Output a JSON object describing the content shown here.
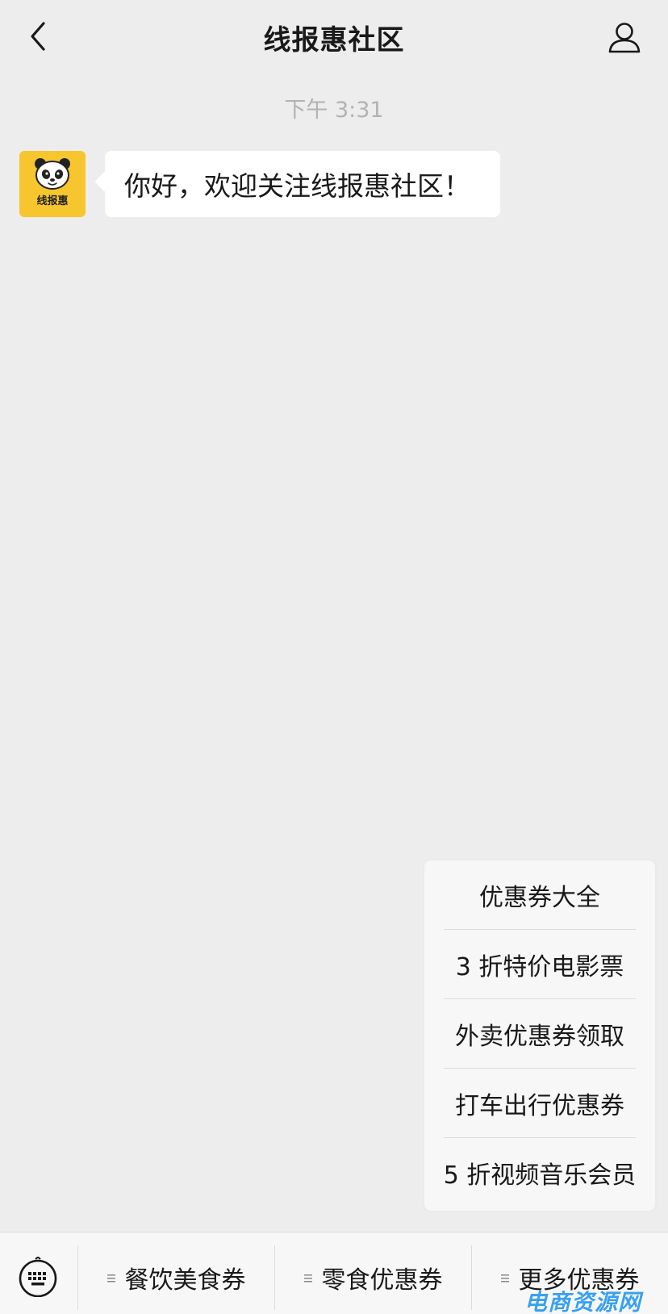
{
  "header": {
    "title": "线报惠社区",
    "back_icon": "chevron-left-icon",
    "profile_icon": "person-icon"
  },
  "chat": {
    "timestamp": "下午 3:31",
    "avatar_label": "线报惠",
    "message": "你好，欢迎关注线报惠社区！"
  },
  "menu": {
    "items": [
      {
        "label": "优惠券大全"
      },
      {
        "label": "3 折特价电影票"
      },
      {
        "label": "外卖优惠券领取"
      },
      {
        "label": "打车出行优惠券"
      },
      {
        "label": "5 折视频音乐会员"
      }
    ]
  },
  "bottom_bar": {
    "keyboard_icon": "keyboard-icon",
    "items": [
      {
        "label": "餐饮美食券"
      },
      {
        "label": "零食优惠券"
      },
      {
        "label": "更多优惠券"
      }
    ]
  },
  "watermark": "电商资源网",
  "colors": {
    "background": "#ededed",
    "avatar": "#f7c62f",
    "bubble": "#ffffff",
    "menu": "#f7f7f7",
    "watermark": "#3aa0f0"
  }
}
